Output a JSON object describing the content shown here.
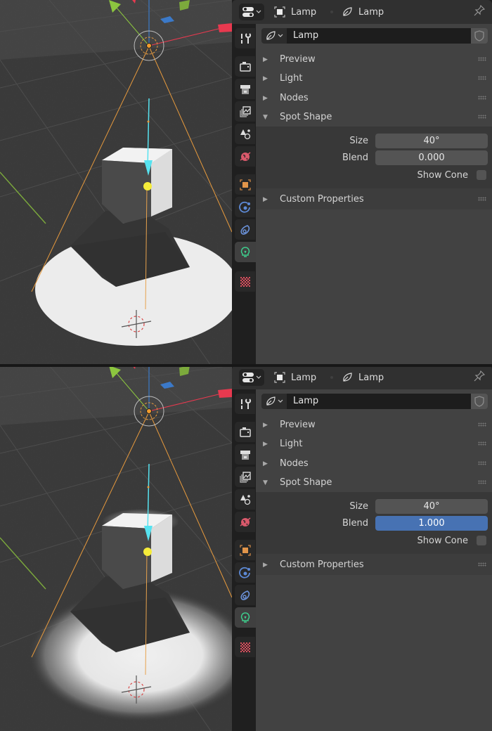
{
  "screens": [
    {
      "id": "top",
      "properties": {
        "breadcrumb": {
          "object_label": "Lamp",
          "data_label": "Lamp"
        },
        "datablock": {
          "name": "Lamp"
        },
        "panels": {
          "preview": "Preview",
          "light": "Light",
          "nodes": "Nodes",
          "spot_shape": "Spot Shape",
          "custom_properties": "Custom Properties"
        },
        "spot_shape": {
          "size_label": "Size",
          "size_value": "40°",
          "blend_label": "Blend",
          "blend_value": "0.000",
          "show_cone_label": "Show Cone",
          "show_cone_checked": false
        }
      },
      "viewport": {
        "blend": 0.0,
        "spot_edge": "hard"
      }
    },
    {
      "id": "bottom",
      "properties": {
        "breadcrumb": {
          "object_label": "Lamp",
          "data_label": "Lamp"
        },
        "datablock": {
          "name": "Lamp"
        },
        "panels": {
          "preview": "Preview",
          "light": "Light",
          "nodes": "Nodes",
          "spot_shape": "Spot Shape",
          "custom_properties": "Custom Properties"
        },
        "spot_shape": {
          "size_label": "Size",
          "size_value": "40°",
          "blend_label": "Blend",
          "blend_value": "1.000",
          "blend_selected": true,
          "show_cone_label": "Show Cone",
          "show_cone_checked": false
        }
      },
      "viewport": {
        "blend": 1.0,
        "spot_edge": "soft"
      }
    }
  ],
  "tabs": [
    {
      "name": "tool",
      "icon": "tool-icon"
    },
    {
      "name": "render",
      "icon": "render-icon"
    },
    {
      "name": "output",
      "icon": "output-icon"
    },
    {
      "name": "view-layer",
      "icon": "view-layer-icon"
    },
    {
      "name": "scene",
      "icon": "scene-icon"
    },
    {
      "name": "world",
      "icon": "world-icon"
    },
    {
      "name": "object",
      "icon": "object-icon"
    },
    {
      "name": "physics",
      "icon": "physics-icon"
    },
    {
      "name": "constraints",
      "icon": "constraints-icon"
    },
    {
      "name": "light-data",
      "icon": "light-bulb-icon",
      "active": true
    },
    {
      "name": "texture",
      "icon": "texture-icon"
    }
  ],
  "colors": {
    "accent_selected": "#4772b3",
    "light_tab": "#3ecf8e",
    "object_orange": "#e2954a",
    "axis_x": "#e8394f",
    "axis_y": "#8cc63f",
    "axis_z": "#3b79c8",
    "light_line": "#e79a3d",
    "direction_cyan": "#57e3f0",
    "light_yellow": "#f5ec3a"
  }
}
